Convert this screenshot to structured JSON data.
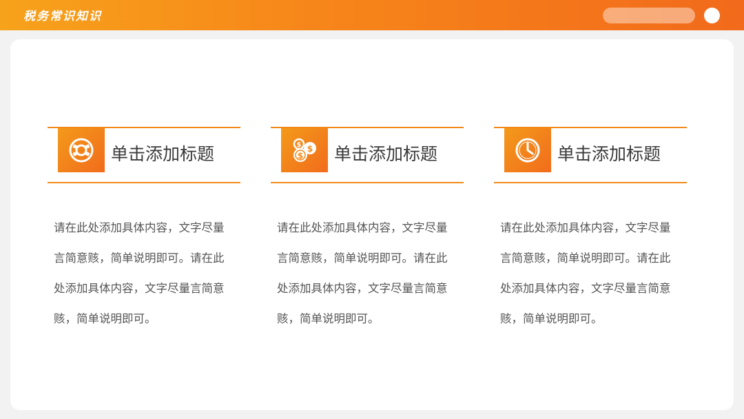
{
  "header": {
    "title": "税务常识知识"
  },
  "columns": [
    {
      "icon": "lifebuoy-icon",
      "title": "单击添加标题",
      "body": "请在此处添加具体内容，文字尽量言简意赅，简单说明即可。请在此处添加具体内容，文字尽量言简意赅，简单说明即可。"
    },
    {
      "icon": "coins-icon",
      "title": "单击添加标题",
      "body": "请在此处添加具体内容，文字尽量言简意赅，简单说明即可。请在此处添加具体内容，文字尽量言简意赅，简单说明即可。"
    },
    {
      "icon": "clock-icon",
      "title": "单击添加标题",
      "body": "请在此处添加具体内容，文字尽量言简意赅，简单说明即可。请在此处添加具体内容，文字尽量言简意赅，简单说明即可。"
    }
  ],
  "colors": {
    "accent_start": "#f7a21b",
    "accent_end": "#f26a1b",
    "rule": "#f28a1a",
    "title_text": "#3a3a3a",
    "body_text": "#555555"
  }
}
